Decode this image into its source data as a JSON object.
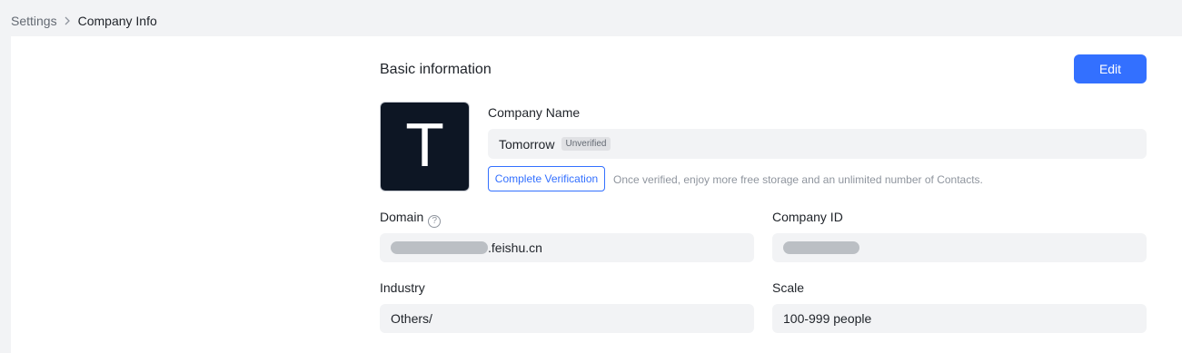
{
  "breadcrumb": {
    "parent": "Settings",
    "separator_icon": "chevron-right-icon",
    "current": "Company Info"
  },
  "basic_info": {
    "title": "Basic information",
    "edit_label": "Edit",
    "logo_letter": "T",
    "company_name": {
      "label": "Company Name",
      "value": "Tomorrow",
      "badge": "Unverified"
    },
    "verification": {
      "button_label": "Complete Verification",
      "hint": "Once verified, enjoy more free storage and an unlimited number of Contacts."
    },
    "domain": {
      "label": "Domain",
      "help_icon": "question-circle-icon",
      "suffix": ".feishu.cn"
    },
    "company_id": {
      "label": "Company ID"
    },
    "industry": {
      "label": "Industry",
      "value": "Others/"
    },
    "scale": {
      "label": "Scale",
      "value": "100-999 people"
    }
  },
  "colors": {
    "accent": "#3370ff",
    "logo_bg": "#0d1624",
    "page_bg": "#f2f3f5"
  }
}
